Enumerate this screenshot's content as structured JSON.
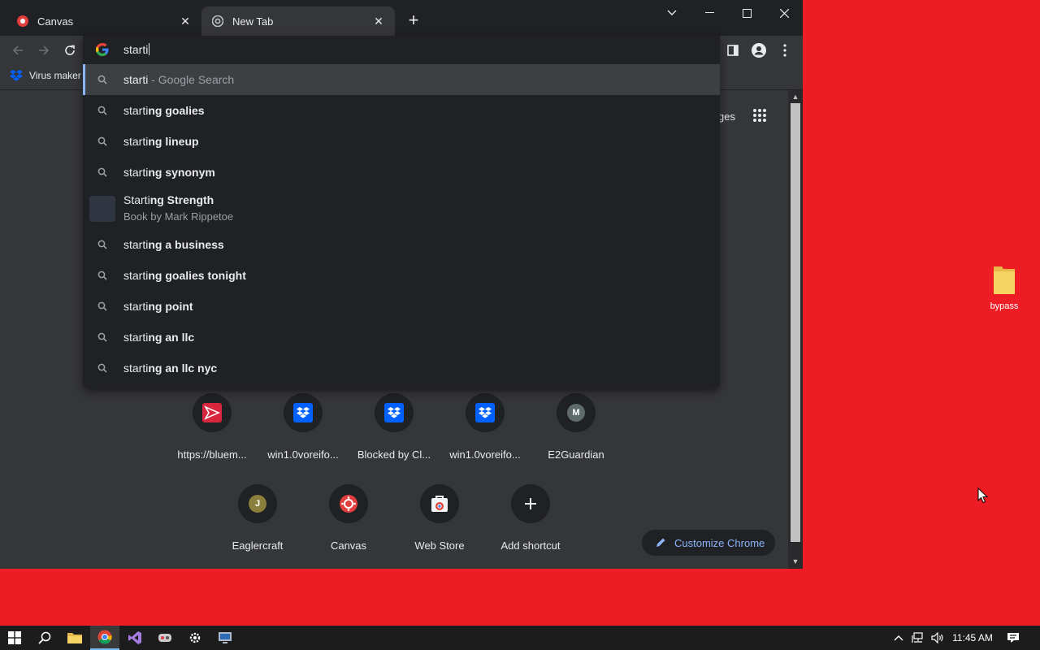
{
  "tabs": [
    {
      "title": "Canvas",
      "icon": "canvas-icon",
      "active": false
    },
    {
      "title": "New Tab",
      "icon": "chrome-icon",
      "active": true
    }
  ],
  "bookmarks": [
    {
      "label": "Virus maker",
      "icon": "dropbox-icon"
    }
  ],
  "omnibox": {
    "input_value": "starti",
    "suggestions": [
      {
        "typed": "starti",
        "rest": "",
        "suffix": " - Google Search",
        "icon": "search-icon"
      },
      {
        "typed": "starti",
        "rest": "ng goalies",
        "icon": "search-icon"
      },
      {
        "typed": "starti",
        "rest": "ng lineup",
        "icon": "search-icon"
      },
      {
        "typed": "starti",
        "rest": "ng synonym",
        "icon": "search-icon"
      },
      {
        "typed": "Starti",
        "rest": "ng Strength",
        "subtitle": "Book by Mark Rippetoe",
        "icon": "entity-thumbnail"
      },
      {
        "typed": "starti",
        "rest": "ng a business",
        "icon": "search-icon"
      },
      {
        "typed": "starti",
        "rest": "ng goalies tonight",
        "icon": "search-icon"
      },
      {
        "typed": "starti",
        "rest": "ng point",
        "icon": "search-icon"
      },
      {
        "typed": "starti",
        "rest": "ng an llc",
        "icon": "search-icon"
      },
      {
        "typed": "starti",
        "rest": "ng an llc nyc",
        "icon": "search-icon"
      }
    ]
  },
  "ntp": {
    "header_partial": "ges",
    "shortcuts_row1": [
      {
        "label": "https://bluem...",
        "icon": "arrow-logo-icon"
      },
      {
        "label": "win1.0voreifo...",
        "icon": "dropbox-icon"
      },
      {
        "label": "Blocked by Cl...",
        "icon": "dropbox-icon"
      },
      {
        "label": "win1.0voreifo...",
        "icon": "dropbox-icon"
      },
      {
        "label": "E2Guardian",
        "letter": "M"
      }
    ],
    "shortcuts_row2": [
      {
        "label": "Eaglercraft",
        "letter": "J"
      },
      {
        "label": "Canvas",
        "icon": "canvas-icon"
      },
      {
        "label": "Web Store",
        "icon": "web-store-icon"
      },
      {
        "label": "Add shortcut",
        "icon": "plus-icon"
      }
    ],
    "customize_label": "Customize Chrome"
  },
  "desktop": {
    "icons": [
      {
        "label": "bypass",
        "icon": "folder-icon"
      }
    ]
  },
  "taskbar": {
    "time": "11:45 AM"
  },
  "colors": {
    "desktop_bg": "#ee1c25",
    "accent": "#8ab4f8",
    "browser_bg": "#35363a",
    "dropdown_bg": "#202124"
  }
}
